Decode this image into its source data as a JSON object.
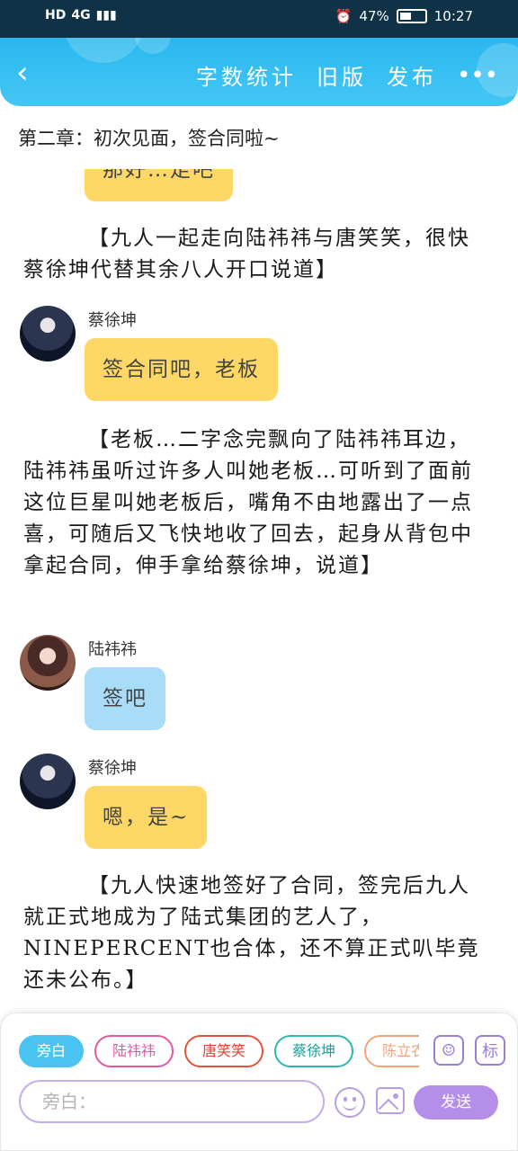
{
  "status_bar": {
    "network": "HD",
    "signal": "4G",
    "battery": "47%",
    "time": "10:27"
  },
  "nav": {
    "back_icon": "chevron-left-icon",
    "word_count": "字数统计",
    "old_version": "旧版",
    "publish": "发布",
    "more": "•••"
  },
  "chapter_title": "第二章：初次见面，签合同啦~",
  "story": {
    "partial_bubble_text": "那好…走吧",
    "narration_1": "【九人一起走向陆祎祎与唐笑笑，很快蔡徐坤代替其余八人开口说道】",
    "msg_1": {
      "speaker": "蔡徐坤",
      "text": "签合同吧，老板"
    },
    "narration_2": "【老板…二字念完飘向了陆祎祎耳边，陆祎祎虽听过许多人叫她老板…可听到了面前这位巨星叫她老板后，嘴角不由地露出了一点喜，可随后又飞快地收了回去，起身从背包中拿起合同，伸手拿给蔡徐坤，说道】",
    "msg_2": {
      "speaker": "陆祎祎",
      "text": "签吧"
    },
    "msg_3": {
      "speaker": "蔡徐坤",
      "text": "嗯，是~"
    },
    "narration_3": "【九人快速地签好了合同，签完后九人就正式地成为了陆式集团的艺人了，NINEPERCENT也合体，还不算正式叭毕竟还未公布。】"
  },
  "composer": {
    "roles": [
      "旁白",
      "陆祎祎",
      "唐笑笑",
      "蔡徐坤",
      "陈立农"
    ],
    "role_icon": "person-icon",
    "tag_button": "标",
    "input_placeholder": "旁白：",
    "emoji_icon": "emoji-icon",
    "image_icon": "image-icon",
    "send": "发送"
  },
  "colors": {
    "accent": "#2ebaf0",
    "bubble_yellow": "#fdd866",
    "bubble_blue": "#a8dcf7",
    "send": "#b48ee8"
  }
}
